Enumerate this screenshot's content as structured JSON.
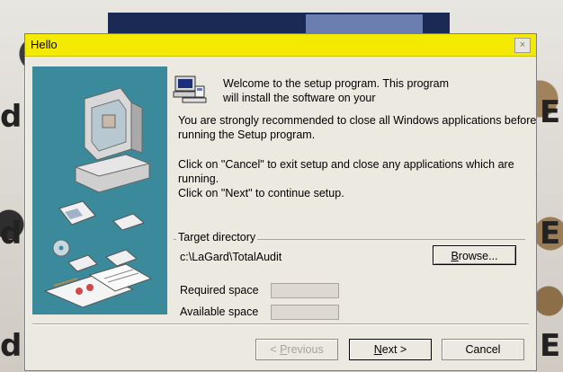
{
  "dialog": {
    "title": "Hello",
    "close_glyph": "×",
    "welcome_text": "Welcome to the setup program. This program will install the software on your",
    "paragraph_recommend": "You are strongly recommended to close all Windows applications before running the Setup program.",
    "paragraph_cancel": "Click on \"Cancel\" to exit setup and close any applications which are running.",
    "paragraph_next": "Click on \"Next\" to continue setup.",
    "target": {
      "label": "Target directory",
      "path": "c:\\LaGard\\TotalAudit",
      "browse_label": "Browse...",
      "browse_underline": "B",
      "browse_rest": "rowse..."
    },
    "space": {
      "required_label": "Required space",
      "available_label": "Available space"
    },
    "buttons": {
      "previous_underline": "P",
      "previous_rest": "revious",
      "previous_prefix": "< ",
      "next_underline": "N",
      "next_rest": "ext >",
      "cancel": "Cancel"
    }
  },
  "icons": {
    "welcome": "computer-setup-icon",
    "close": "close-icon",
    "side_art": "computer-install-illustration"
  },
  "colors": {
    "titlebar": "#f4ea00",
    "side_panel": "#3a8a9c",
    "dialog_bg": "#ece9e0"
  }
}
